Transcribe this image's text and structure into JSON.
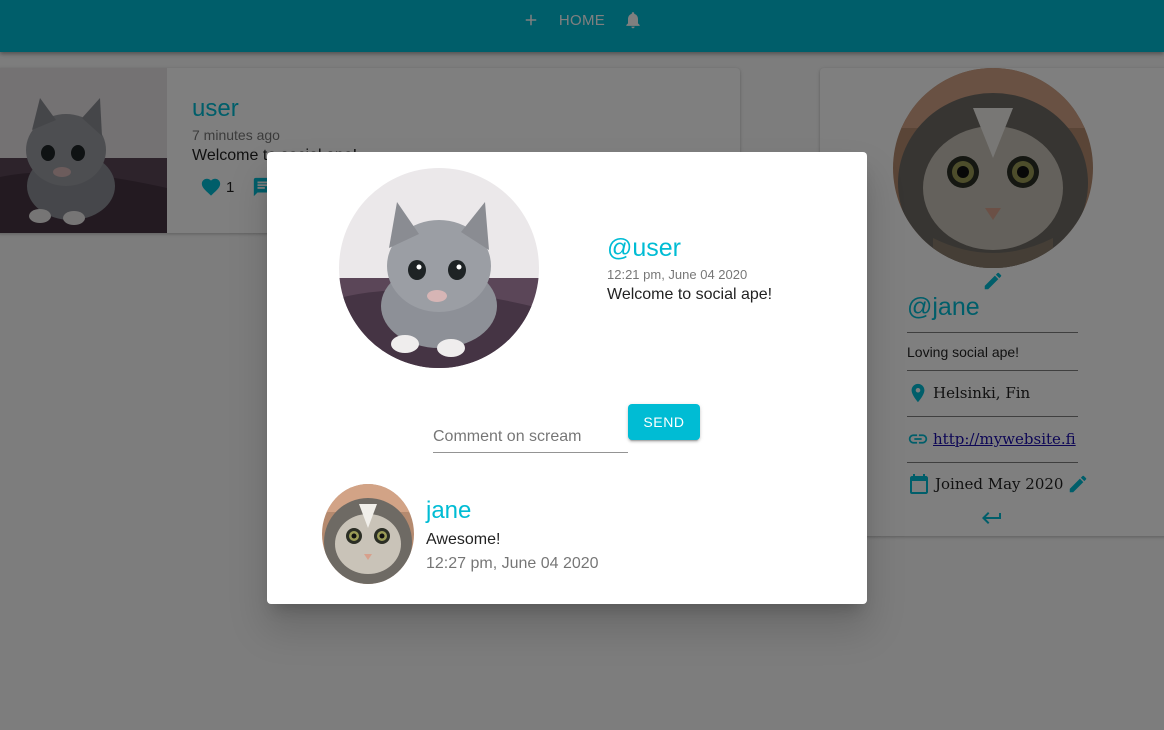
{
  "colors": {
    "primary": "#00bcd4",
    "backdrop": "rgba(0,0,0,0.5)",
    "link": "#1a0dab"
  },
  "navbar": {
    "home_label": "HOME",
    "icons": [
      "add-icon",
      "notifications-icon"
    ]
  },
  "scream_card": {
    "user": "user",
    "time": "7 minutes ago",
    "body": "Welcome to social ape!",
    "like_count": "1",
    "icons": [
      "favorite-icon",
      "chat-icon"
    ]
  },
  "profile": {
    "handle": "@jane",
    "bio": "Loving social ape!",
    "location": "Helsinki, Fin",
    "website": "http://mywebsite.fi",
    "joined": "Joined May 2020",
    "icons": [
      "edit-icon",
      "location-icon",
      "link-icon",
      "calendar-icon",
      "keyboard-return-icon"
    ]
  },
  "dialog": {
    "handle": "@user",
    "timestamp": "12:21 pm, June 04 2020",
    "body": "Welcome to social ape!",
    "comment_placeholder": "Comment on scream",
    "send_label": "SEND",
    "comments": [
      {
        "user": "jane",
        "body": "Awesome!",
        "time": "12:27 pm, June 04 2020"
      }
    ]
  }
}
